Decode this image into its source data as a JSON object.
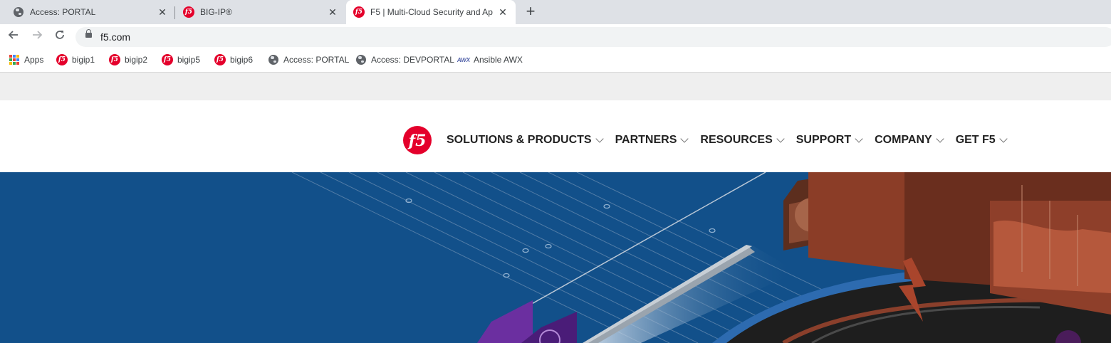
{
  "browser": {
    "tabs": [
      {
        "title": "Access: PORTAL",
        "icon": "globe-icon"
      },
      {
        "title": "BIG-IP®",
        "icon": "f5-logo-icon"
      },
      {
        "title": "F5 | Multi-Cloud Security and Ap",
        "icon": "f5-logo-icon",
        "active": true
      }
    ],
    "new_tab_symbol": "+",
    "close_symbol": "✕",
    "url": "f5.com",
    "bookmarks": [
      {
        "label": "Apps",
        "icon": "apps-grid-icon"
      },
      {
        "label": "bigip1",
        "icon": "f5-logo-icon"
      },
      {
        "label": "bigip2",
        "icon": "f5-logo-icon"
      },
      {
        "label": "bigip5",
        "icon": "f5-logo-icon"
      },
      {
        "label": "bigip6",
        "icon": "f5-logo-icon"
      },
      {
        "label": "Access: PORTAL",
        "icon": "globe-icon"
      },
      {
        "label": "Access: DEVPORTAL",
        "icon": "globe-icon"
      },
      {
        "label": "Ansible AWX",
        "icon": "awx-icon",
        "icon_text": "AWX"
      }
    ]
  },
  "site": {
    "logo_text": "f5",
    "nav": [
      {
        "label": "SOLUTIONS & PRODUCTS"
      },
      {
        "label": "PARTNERS"
      },
      {
        "label": "RESOURCES"
      },
      {
        "label": "SUPPORT"
      },
      {
        "label": "COMPANY"
      },
      {
        "label": "GET F5"
      }
    ]
  },
  "colors": {
    "brand_red": "#e4002b",
    "hero_blue": "#12508a",
    "tabstrip": "#dee1e6"
  }
}
